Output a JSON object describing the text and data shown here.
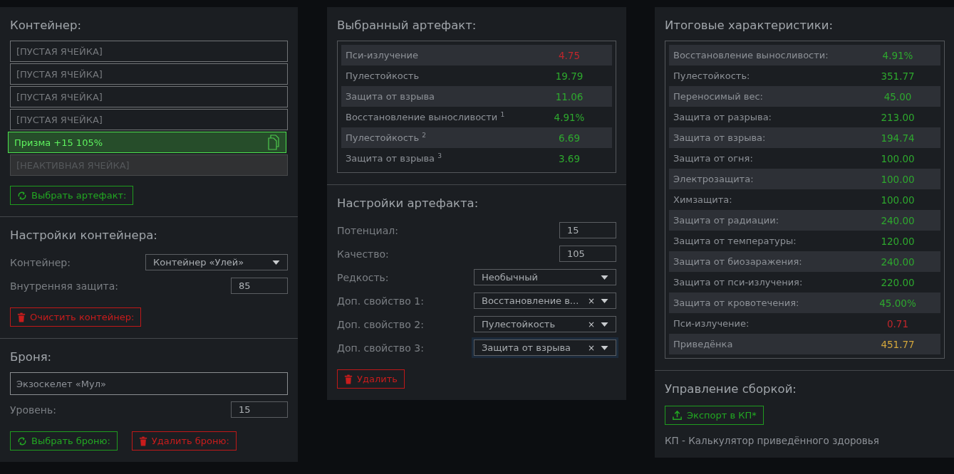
{
  "container_panel": {
    "title": "Контейнер:",
    "slots": [
      {
        "kind": "empty",
        "text": "[ПУСТАЯ ЯЧЕЙКА]"
      },
      {
        "kind": "empty",
        "text": "[ПУСТАЯ ЯЧЕЙКА]"
      },
      {
        "kind": "empty",
        "text": "[ПУСТАЯ ЯЧЕЙКА]"
      },
      {
        "kind": "empty",
        "text": "[ПУСТАЯ ЯЧЕЙКА]"
      },
      {
        "kind": "artifact",
        "text": "Призма +15 105%"
      },
      {
        "kind": "inactive",
        "text": "[НЕАКТИВНАЯ ЯЧЕЙКА]"
      }
    ],
    "buttons": [
      {
        "kind": "select",
        "label": "Выбрать артефакт:"
      }
    ]
  },
  "container_settings": {
    "title": "Настройки контейнера:",
    "fields": [
      {
        "kind": "select",
        "label": "Контейнер:",
        "value": "Контейнер «Улей»",
        "focused": false
      },
      {
        "kind": "input",
        "label": "Внутренняя защита:",
        "value": "85"
      }
    ],
    "buttons": [
      {
        "kind": "delete",
        "label": "Очистить контейнер:"
      }
    ]
  },
  "armor": {
    "title": "Броня:",
    "name": "Экзоскелет «Мул»",
    "fields": [
      {
        "kind": "input",
        "label": "Уровень:",
        "value": "15"
      }
    ],
    "buttons": [
      {
        "kind": "select",
        "label": "Выбрать броню:"
      },
      {
        "kind": "delete",
        "label": "Удалить броню:"
      }
    ]
  },
  "selected_artifact": {
    "title": "Выбранный артефакт:",
    "stats": [
      {
        "label": "Пси-излучение",
        "value": "4.75",
        "color": "#c0262c"
      },
      {
        "label": "Пулестойкость",
        "value": "19.79",
        "color": "#2ea82e"
      },
      {
        "label": "Защита от взрыва",
        "value": "11.06",
        "color": "#2ea82e"
      },
      {
        "label": "Восстановление выносливости $^{1}$",
        "value": "4.91%",
        "color": "#2ea82e"
      },
      {
        "label": "Пулестойкость $^{2}$",
        "value": "6.69",
        "color": "#2ea82e"
      },
      {
        "label": "Защита от взрыва $^{3}$",
        "value": "3.69",
        "color": "#2ea82e"
      }
    ]
  },
  "artifact_settings": {
    "title": "Настройки артефакта:",
    "fields": [
      {
        "kind": "input",
        "label": "Потенциал:",
        "value": "15"
      },
      {
        "kind": "input",
        "label": "Качество:",
        "value": "105"
      },
      {
        "kind": "select",
        "label": "Редкость:",
        "value": "Необычный",
        "focused": false
      },
      {
        "kind": "select",
        "label": "Доп. свойство 1:",
        "value": "Восстановление в...",
        "clear": "×",
        "focused": false
      },
      {
        "kind": "select",
        "label": "Доп. свойство 2:",
        "value": "Пулестойкость",
        "clear": "×",
        "focused": false
      },
      {
        "kind": "select",
        "label": "Доп. свойство 3:",
        "value": "Защита от взрыва",
        "clear": "×",
        "focused": true
      }
    ],
    "buttons": [
      {
        "kind": "delete",
        "label": "Удалить"
      }
    ]
  },
  "totals": {
    "title": "Итоговые характеристики:",
    "stats": [
      {
        "label": "Восстановление выносливости:",
        "value": "4.91%",
        "color": "#2ea82e"
      },
      {
        "label": "Пулестойкость:",
        "value": "351.77",
        "color": "#2ea82e"
      },
      {
        "label": "Переносимый вес:",
        "value": "45.00",
        "color": "#2ea82e"
      },
      {
        "label": "Защита от разрыва:",
        "value": "213.00",
        "color": "#2ea82e"
      },
      {
        "label": "Защита от взрыва:",
        "value": "194.74",
        "color": "#2ea82e"
      },
      {
        "label": "Защита от огня:",
        "value": "100.00",
        "color": "#2ea82e"
      },
      {
        "label": "Электрозащита:",
        "value": "100.00",
        "color": "#2ea82e"
      },
      {
        "label": "Химзащита:",
        "value": "100.00",
        "color": "#2ea82e"
      },
      {
        "label": "Защита от радиации:",
        "value": "240.00",
        "color": "#2ea82e"
      },
      {
        "label": "Защита от температуры:",
        "value": "120.00",
        "color": "#2ea82e"
      },
      {
        "label": "Защита от биозаражения:",
        "value": "240.00",
        "color": "#2ea82e"
      },
      {
        "label": "Защита от пси-излучения:",
        "value": "220.00",
        "color": "#2ea82e"
      },
      {
        "label": "Защита от кровотечения:",
        "value": "45.00%",
        "color": "#2ea82e"
      },
      {
        "label": "Пси-излучение:",
        "value": "0.71",
        "color": "#c0262c"
      },
      {
        "label": "Приведёнка",
        "value": "451.77",
        "color": "#d2a63c"
      }
    ]
  },
  "build": {
    "title": "Управление сборкой:",
    "buttons": [
      {
        "kind": "export",
        "label": "Экспорт в КП*"
      }
    ],
    "note": "КП - Калькулятор приведённого здоровья"
  }
}
